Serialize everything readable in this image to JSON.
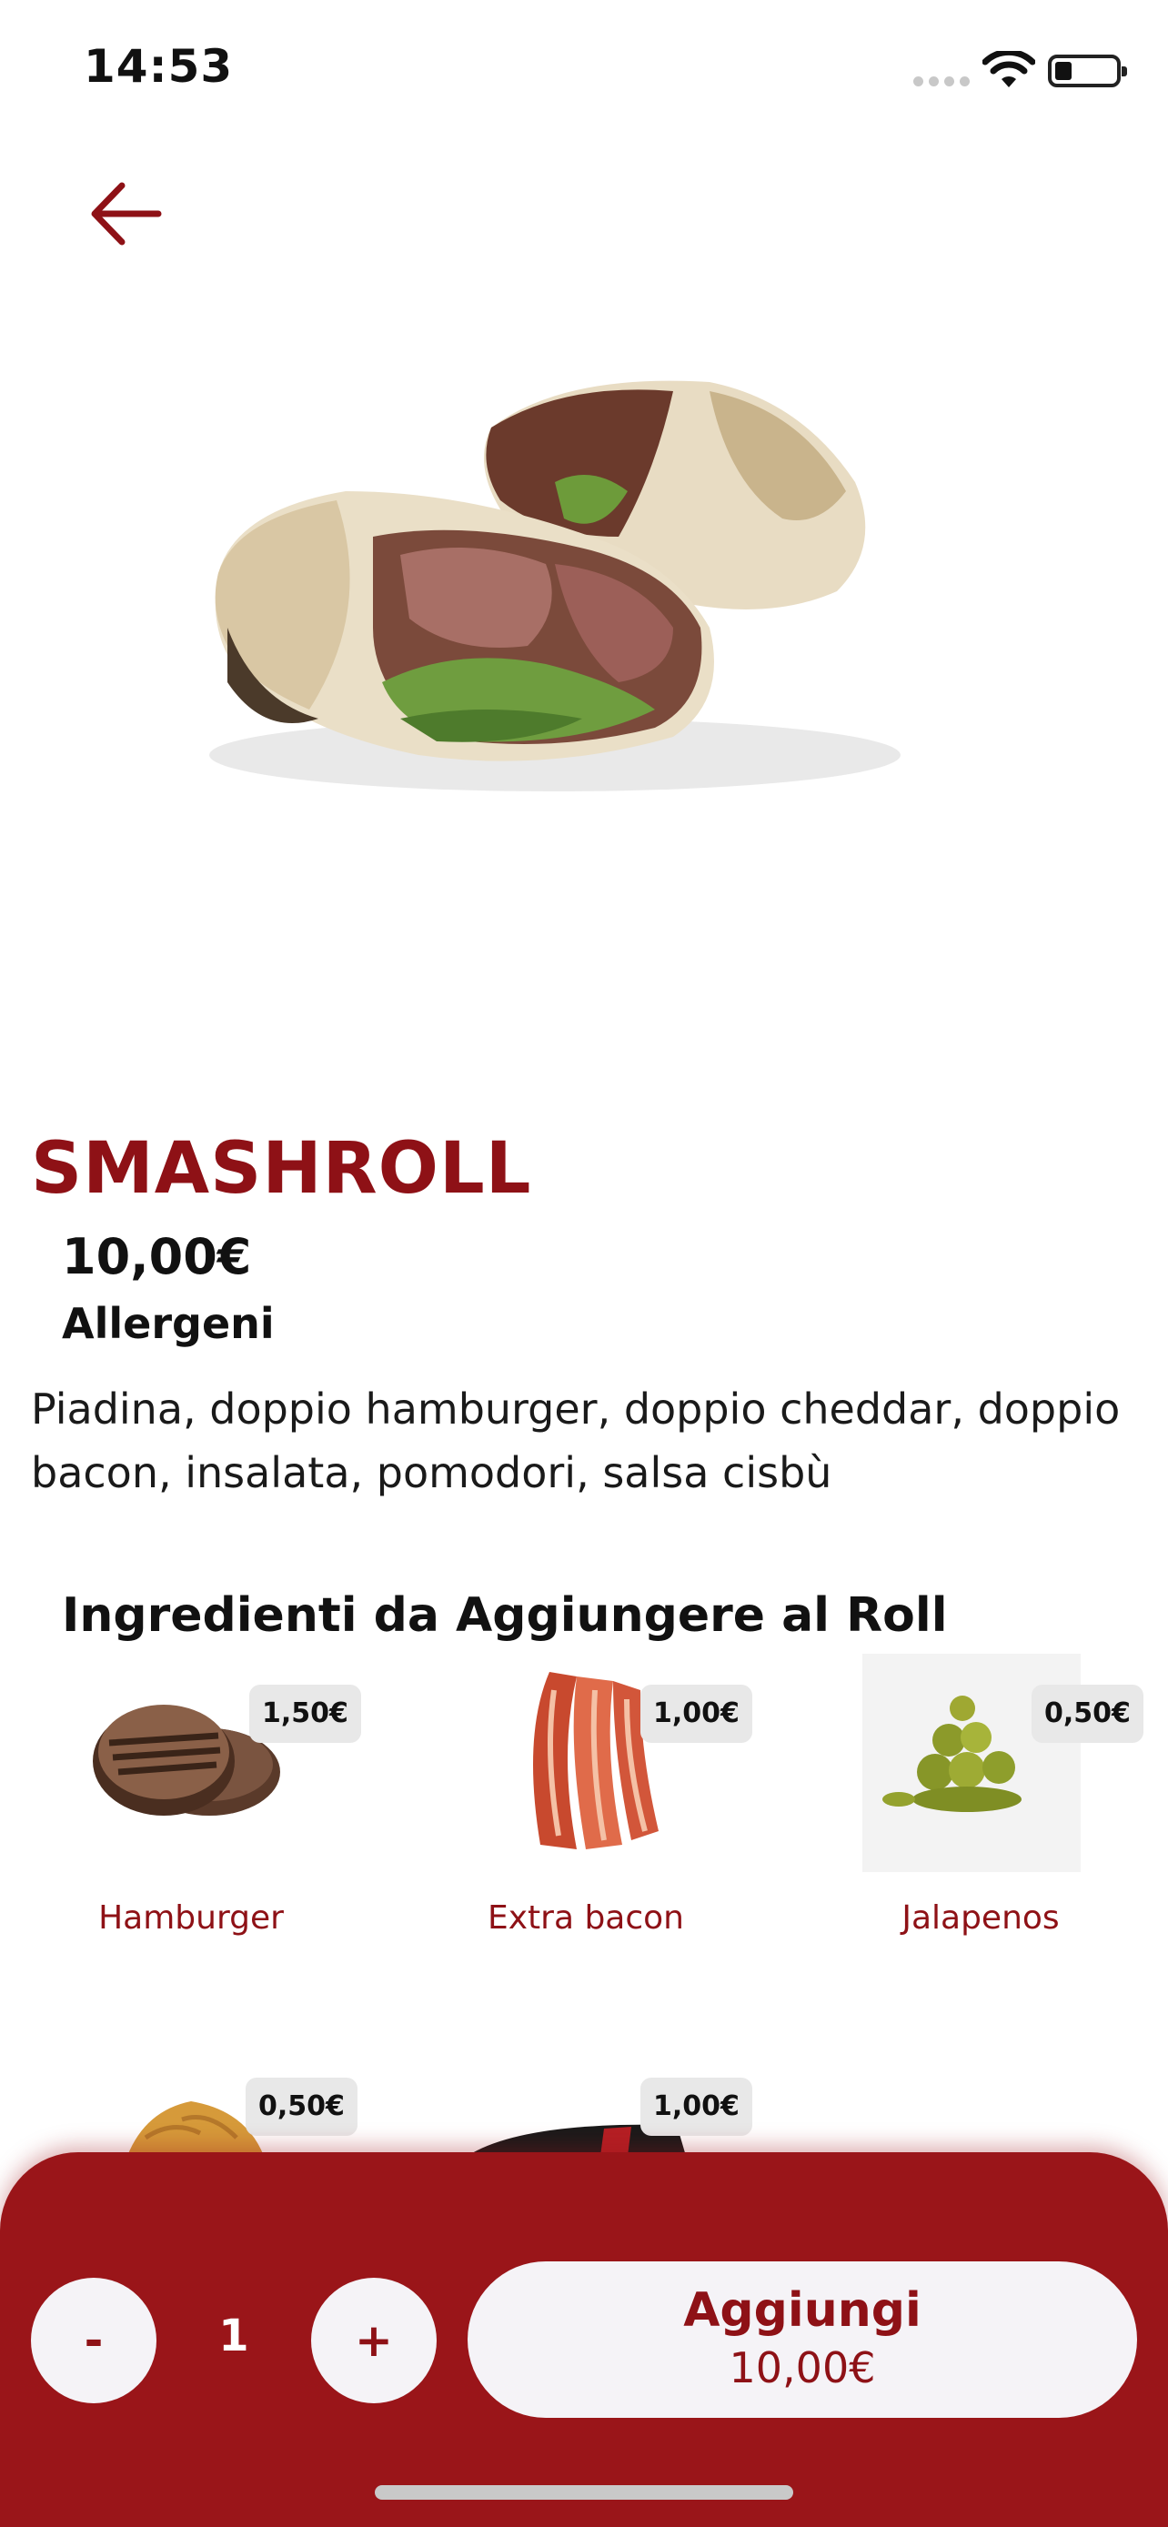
{
  "status_bar": {
    "time": "14:53"
  },
  "product": {
    "name": "SMASHROLL",
    "price": "10,00€",
    "allergens_label": "Allergeni",
    "description": "Piadina, doppio hamburger, doppio cheddar, doppio bacon, insalata, pomodori, salsa cisbù"
  },
  "extras_section": {
    "title": "Ingredienti da Aggiungere al Roll",
    "items": [
      {
        "name": "Hamburger",
        "price": "1,50€"
      },
      {
        "name": "Extra bacon",
        "price": "1,00€"
      },
      {
        "name": "Jalapenos",
        "price": "0,50€"
      },
      {
        "name": "",
        "price": "0,50€"
      },
      {
        "name": "",
        "price": "1,00€"
      }
    ]
  },
  "cart_bar": {
    "minus_label": "-",
    "quantity": "1",
    "plus_label": "+",
    "add_label": "Aggiungi",
    "add_price": "10,00€"
  },
  "colors": {
    "brand": "#9a1519",
    "title": "#8e1116",
    "button_bg": "#f5f3f7",
    "badge_bg": "#e8e8e8"
  }
}
